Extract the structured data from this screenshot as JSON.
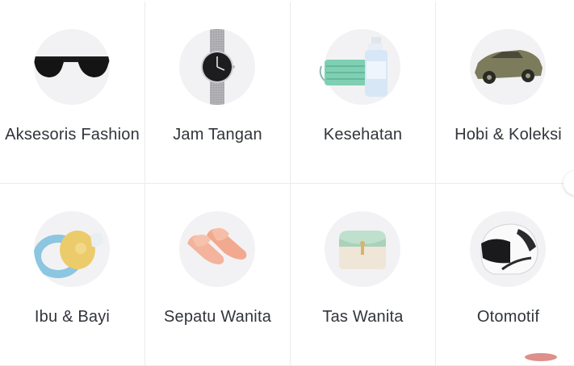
{
  "categories": [
    {
      "label": "Aksesoris Fashion",
      "icon": "sunglasses-icon"
    },
    {
      "label": "Jam Tangan",
      "icon": "wristwatch-icon"
    },
    {
      "label": "Kesehatan",
      "icon": "mask-sanitizer-icon"
    },
    {
      "label": "Hobi & Koleksi",
      "icon": "toy-car-icon"
    },
    {
      "label": "Ibu & Bayi",
      "icon": "pacifier-icon"
    },
    {
      "label": "Sepatu Wanita",
      "icon": "sandals-icon"
    },
    {
      "label": "Tas Wanita",
      "icon": "handbag-icon"
    },
    {
      "label": "Otomotif",
      "icon": "helmet-icon"
    }
  ]
}
